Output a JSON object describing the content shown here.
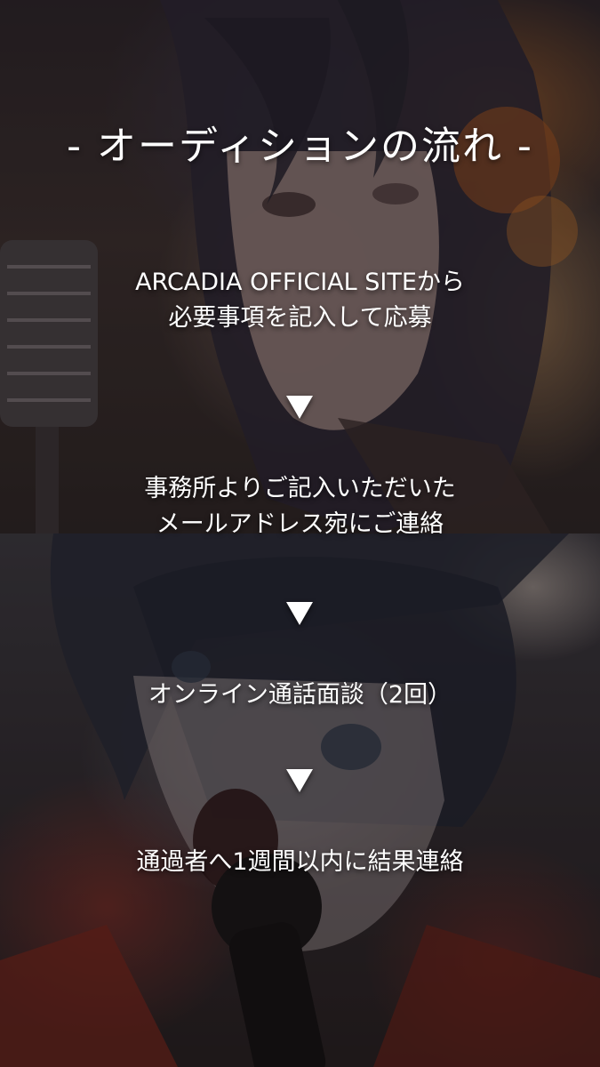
{
  "title": "- オーディションの流れ -",
  "steps": [
    {
      "lines": [
        "ARCADIA OFFICIAL SITEから",
        "必要事項を記入して応募"
      ]
    },
    {
      "lines": [
        "事務所よりご記入いただいた",
        "メールアドレス宛にご連絡"
      ]
    },
    {
      "lines": [
        "オンライン通話面談（2回）"
      ]
    },
    {
      "lines": [
        "通過者へ1週間以内に結果連絡"
      ]
    }
  ],
  "colors": {
    "text": "#ffffff",
    "arrow": "#ffffff"
  },
  "icons": {
    "flow_arrow": "down-triangle-icon"
  }
}
